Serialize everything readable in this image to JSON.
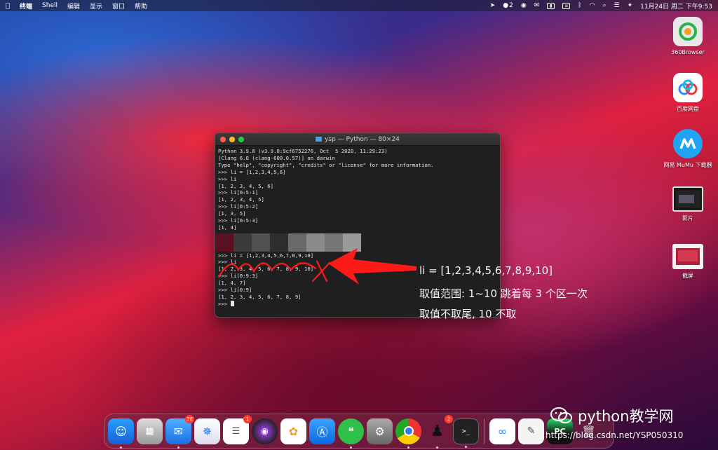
{
  "menubar": {
    "app_name": "终端",
    "menus": [
      "Shell",
      "编辑",
      "显示",
      "窗口",
      "帮助"
    ],
    "notification_count": "2",
    "datetime": "11月24日 周二 下午9:53"
  },
  "terminal": {
    "title": "ysp — Python — 80×24",
    "lines": [
      "Python 3.9.0 (v3.9.0:9cf6752276, Oct  5 2020, 11:29:23)",
      "[Clang 6.0 (clang-600.0.57)] on darwin",
      "Type \"help\", \"copyright\", \"credits\" or \"license\" for more information.",
      ">>> li = [1,2,3,4,5,6]",
      ">>> li",
      "[1, 2, 3, 4, 5, 6]",
      ">>> li[0:5:1]",
      "[1, 2, 3, 4, 5]",
      ">>> li[0:5:2]",
      "[1, 3, 5]",
      ">>> li[0:5:3]",
      "[1, 4]",
      "",
      "",
      "",
      ">>> li = [1,2,3,4,5,6,7,8,9,10]",
      ">>> li",
      "[1, 2, 3, 4, 5, 6, 7, 8, 9, 10]",
      ">>> li[0:9:3]",
      "[1, 4, 7]",
      ">>> li[0:9]",
      "[1, 2, 3, 4, 5, 6, 7, 8, 9]",
      ">>> "
    ]
  },
  "annotation": {
    "line1": "li = [1,2,3,4,5,6,7,8,9,10]",
    "line2": "取值范围: 1~10 跳着每 3 个区一次",
    "line3": "取值不取尾, 10 不取"
  },
  "desktop_icons": [
    {
      "label": "360Browser",
      "icon": "360-browser-icon"
    },
    {
      "label": "百度网盘",
      "icon": "baidu-netdisk-icon"
    },
    {
      "label": "网易 MuMu 下载器",
      "icon": "mumu-icon"
    },
    {
      "label": "影片",
      "icon": "movie-icon"
    },
    {
      "label": "截屏",
      "icon": "screenshot-icon"
    }
  ],
  "dock": {
    "mail_badge": "38",
    "reminders_badge": "1",
    "qq_badge": "2"
  },
  "watermark": {
    "brand": "python教学网",
    "url": "https://blog.csdn.net/YSP050310"
  },
  "colors": {
    "annotation_red": "#ff1a1a",
    "terminal_bg": "#1f1f1f"
  }
}
